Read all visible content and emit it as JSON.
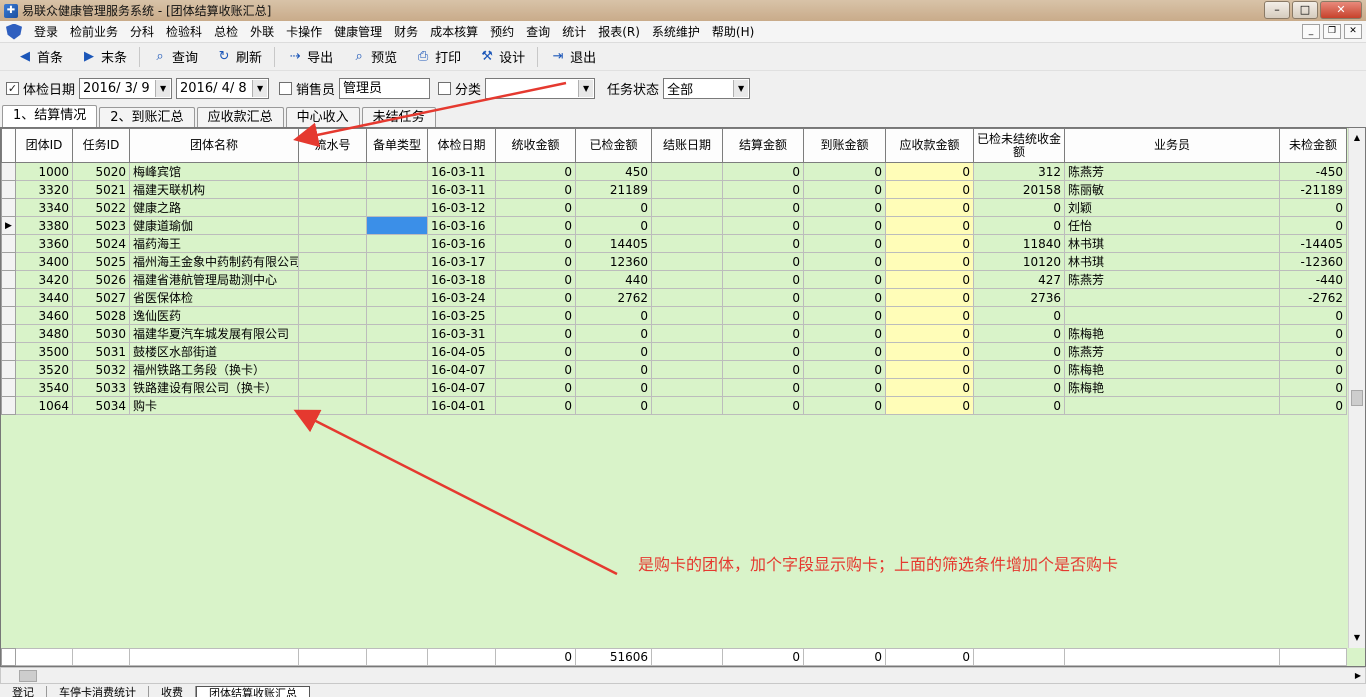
{
  "window": {
    "title": "易联众健康管理服务系统 - [团体结算收账汇总]",
    "controls": [
      "–",
      "□",
      "✕"
    ]
  },
  "menu": [
    "登录",
    "检前业务",
    "分科",
    "检验科",
    "总检",
    "外联",
    "卡操作",
    "健康管理",
    "财务",
    "成本核算",
    "预约",
    "查询",
    "统计",
    "报表(R)",
    "系统维护",
    "帮助(H)"
  ],
  "mdi_controls": [
    "_",
    "❐",
    "✕"
  ],
  "toolbar": [
    {
      "label": "首条",
      "icon": "◀"
    },
    {
      "label": "末条",
      "icon": "▶"
    },
    {
      "label": "查询",
      "icon": "⌕"
    },
    {
      "label": "刷新",
      "icon": "↻"
    },
    {
      "label": "导出",
      "icon": "⇢"
    },
    {
      "label": "预览",
      "icon": "⌕"
    },
    {
      "label": "打印",
      "icon": "⎙"
    },
    {
      "label": "设计",
      "icon": "⚒"
    },
    {
      "label": "退出",
      "icon": "⇥"
    }
  ],
  "filters": {
    "exam_date_checked": true,
    "exam_date_label": "体检日期",
    "date_from": "2016/ 3/ 9",
    "date_to": "2016/ 4/ 8",
    "salesperson_checked": false,
    "salesperson_label": "销售员",
    "salesperson_value": "管理员",
    "category_checked": false,
    "category_label": "分类",
    "category_value": "",
    "task_status_label": "任务状态",
    "task_status_value": "全部"
  },
  "tabs": [
    "1、结算情况",
    "2、到账汇总",
    "应收款汇总",
    "中心收入",
    "未结任务"
  ],
  "active_tab": 0,
  "columns": [
    "团体ID",
    "任务ID",
    "团体名称",
    "流水号",
    "备单类型",
    "体检日期",
    "统收金额",
    "已检金额",
    "结账日期",
    "结算金额",
    "到账金额",
    "应收款金额",
    "已检未结统收金额",
    "业务员",
    "未检金额"
  ],
  "rows": [
    [
      "1000",
      "5020",
      "梅峰宾馆",
      "",
      "",
      "16-03-11",
      "0",
      "450",
      "",
      "0",
      "0",
      "0",
      "312",
      "陈燕芳",
      "-450"
    ],
    [
      "3320",
      "5021",
      "福建天联机构",
      "",
      "",
      "16-03-11",
      "0",
      "21189",
      "",
      "0",
      "0",
      "0",
      "20158",
      "陈丽敏",
      "-21189"
    ],
    [
      "3340",
      "5022",
      "健康之路",
      "",
      "",
      "16-03-12",
      "0",
      "0",
      "",
      "0",
      "0",
      "0",
      "0",
      "刘颖",
      "0"
    ],
    [
      "3380",
      "5023",
      "健康道瑜伽",
      "",
      "",
      "16-03-16",
      "0",
      "0",
      "",
      "0",
      "0",
      "0",
      "0",
      "任怡",
      "0"
    ],
    [
      "3360",
      "5024",
      "福药海王",
      "",
      "",
      "16-03-16",
      "0",
      "14405",
      "",
      "0",
      "0",
      "0",
      "11840",
      "林书琪",
      "-14405"
    ],
    [
      "3400",
      "5025",
      "福州海王金象中药制药有限公司",
      "",
      "",
      "16-03-17",
      "0",
      "12360",
      "",
      "0",
      "0",
      "0",
      "10120",
      "林书琪",
      "-12360"
    ],
    [
      "3420",
      "5026",
      "福建省港航管理局勘测中心",
      "",
      "",
      "16-03-18",
      "0",
      "440",
      "",
      "0",
      "0",
      "0",
      "427",
      "陈燕芳",
      "-440"
    ],
    [
      "3440",
      "5027",
      "省医保体检",
      "",
      "",
      "16-03-24",
      "0",
      "2762",
      "",
      "0",
      "0",
      "0",
      "2736",
      "",
      "-2762"
    ],
    [
      "3460",
      "5028",
      "逸仙医药",
      "",
      "",
      "16-03-25",
      "0",
      "0",
      "",
      "0",
      "0",
      "0",
      "0",
      "",
      "0"
    ],
    [
      "3480",
      "5030",
      "福建华夏汽车城发展有限公司",
      "",
      "",
      "16-03-31",
      "0",
      "0",
      "",
      "0",
      "0",
      "0",
      "0",
      "陈梅艳",
      "0"
    ],
    [
      "3500",
      "5031",
      "鼓楼区水部街道",
      "",
      "",
      "16-04-05",
      "0",
      "0",
      "",
      "0",
      "0",
      "0",
      "0",
      "陈燕芳",
      "0"
    ],
    [
      "3520",
      "5032",
      "福州铁路工务段（换卡）",
      "",
      "",
      "16-04-07",
      "0",
      "0",
      "",
      "0",
      "0",
      "0",
      "0",
      "陈梅艳",
      "0"
    ],
    [
      "3540",
      "5033",
      "铁路建设有限公司（换卡）",
      "",
      "",
      "16-04-07",
      "0",
      "0",
      "",
      "0",
      "0",
      "0",
      "0",
      "陈梅艳",
      "0"
    ],
    [
      "1064",
      "5034",
      "购卡",
      "",
      "",
      "16-04-01",
      "0",
      "0",
      "",
      "0",
      "0",
      "0",
      "0",
      "",
      "0"
    ]
  ],
  "current_row": 3,
  "totals": [
    "",
    "",
    "",
    "",
    "",
    "",
    "0",
    "51606",
    "",
    "0",
    "0",
    "0",
    "",
    "",
    ""
  ],
  "bottom_tabs": [
    "登记",
    "车停卡消费统计",
    "收费",
    "团体结算收账汇总"
  ],
  "annotation": {
    "text": "是购卡的团体，加个字段显示购卡；上面的筛选条件增加个是否购卡",
    "color": "#e5392f"
  }
}
